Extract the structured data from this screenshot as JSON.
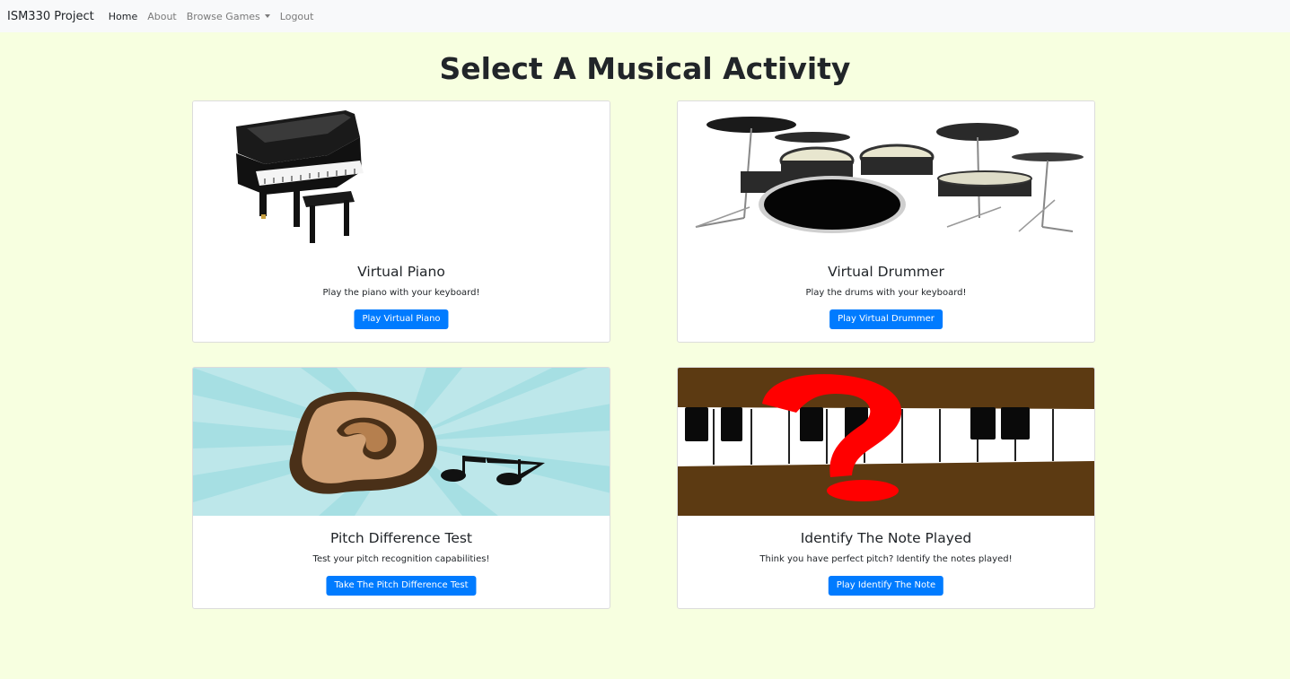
{
  "nav": {
    "brand": "ISM330 Project",
    "links": [
      {
        "label": "Home"
      },
      {
        "label": "About"
      },
      {
        "label": "Browse Games"
      },
      {
        "label": "Logout"
      }
    ]
  },
  "page": {
    "title": "Select A Musical Activity"
  },
  "cards": [
    {
      "title": "Virtual Piano",
      "text": "Play the piano with your keyboard!",
      "button": "Play Virtual Piano",
      "image": "grand-piano-image"
    },
    {
      "title": "Virtual Drummer",
      "text": "Play the drums with your keyboard!",
      "button": "Play Virtual Drummer",
      "image": "drum-kit-image"
    },
    {
      "title": "Pitch Difference Test",
      "text": "Test your pitch recognition capabilities!",
      "button": "Take The Pitch Difference Test",
      "image": "ear-and-music-note-image"
    },
    {
      "title": "Identify The Note Played",
      "text": "Think you have perfect pitch? Identify the notes played!",
      "button": "Play Identify The Note",
      "image": "piano-keys-question-mark-image"
    }
  ],
  "colors": {
    "page_background": "#f7ffe0",
    "navbar_background": "#f8f9fa",
    "button_primary": "#007bff"
  }
}
